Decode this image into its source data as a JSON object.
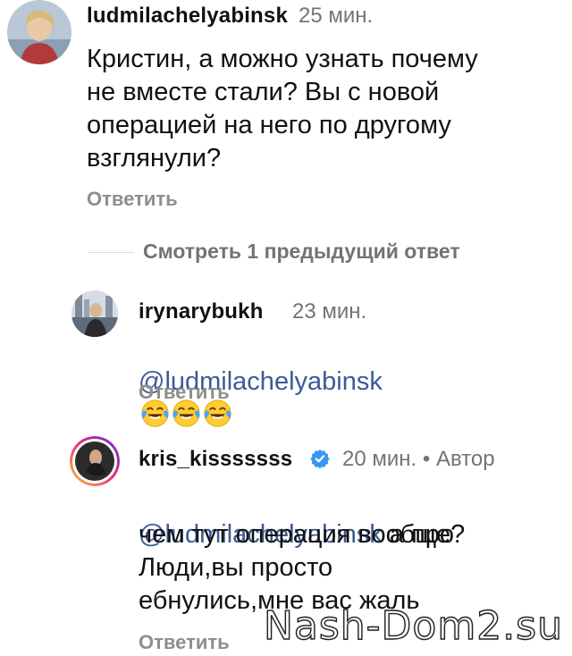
{
  "comments": [
    {
      "username": "ludmilachelyabinsk",
      "time": "25 мин.",
      "text": "Кристин, а можно узнать почему\nне вместе стали? Вы с новой\nоперацией на него по другому\nвзглянули?",
      "reply_label": "Ответить",
      "avatar_icon": "user-avatar-photo"
    },
    {
      "username": "irynarybukh",
      "time": "23 мин.",
      "mention": "@ludmilachelyabinsk",
      "emoji": [
        "tears-of-joy-icon",
        "tears-of-joy-icon",
        "tears-of-joy-icon"
      ],
      "reply_label": "Ответить",
      "avatar_icon": "user-avatar-photo"
    },
    {
      "username": "kris_kisssssss",
      "time": "20 мин.",
      "separator": "•",
      "author_label": "Автор",
      "mention": "@ludmilachelyabinsk",
      "text_after_mention": " а про",
      "text": "чем тут операция вообще?\nЛюди,вы просто\nебнулись,мне вас жаль",
      "reply_label": "Ответить",
      "avatar_icon": "user-avatar-photo-story-ring",
      "verified_icon": "verified-badge-icon"
    }
  ],
  "view_previous": "Смотреть 1 предыдущий ответ",
  "watermark": "Nash-Dom2.su",
  "colors": {
    "mention": "#3d5a96",
    "meta": "#737373",
    "verified": "#3897f0",
    "story_ring": [
      "#f9ce34",
      "#ee2a7b",
      "#6228d7"
    ]
  }
}
